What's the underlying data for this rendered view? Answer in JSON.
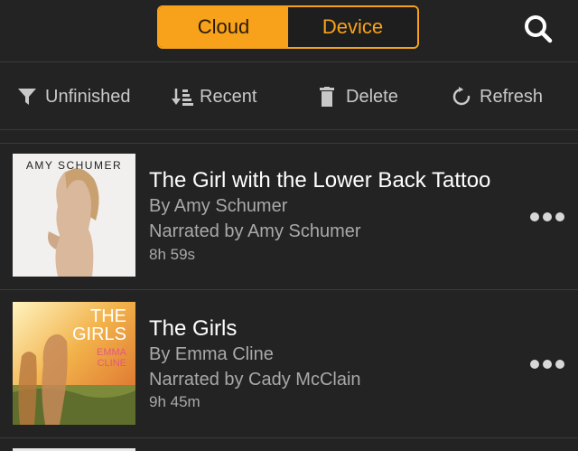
{
  "header": {
    "tabs": [
      {
        "label": "Cloud",
        "active": true
      },
      {
        "label": "Device",
        "active": false
      }
    ],
    "search_icon": "search-icon"
  },
  "toolbar": {
    "filter": {
      "label": "Unfinished",
      "icon": "filter-icon"
    },
    "sort": {
      "label": "Recent",
      "icon": "sort-icon"
    },
    "delete": {
      "label": "Delete",
      "icon": "trash-icon"
    },
    "refresh": {
      "label": "Refresh",
      "icon": "refresh-icon"
    }
  },
  "books": [
    {
      "cover_author_text": "AMY SCHUMER",
      "title": "The Girl with the Lower Back Tattoo",
      "author": "By Amy Schumer",
      "narrator": "Narrated by Amy Schumer",
      "duration": "8h 59s"
    },
    {
      "cover_title_text": "THE GIRLS",
      "cover_author_text": "EMMA CLINE",
      "title": "The Girls",
      "author": "By Emma Cline",
      "narrator": "Narrated by Cady McClain",
      "duration": "9h 45m"
    }
  ],
  "colors": {
    "accent": "#f7a21a",
    "background": "#232323",
    "secondary_text": "#a9a9a9"
  }
}
